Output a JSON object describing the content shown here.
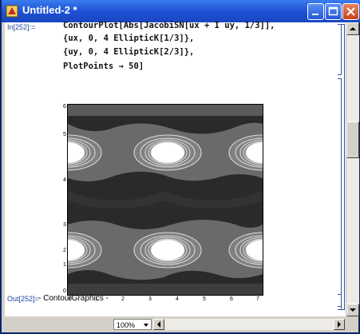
{
  "window": {
    "title": "Untitled-2 *"
  },
  "cell_in": {
    "label": "In[252]:=",
    "lines": [
      "ContourPlot[Abs[JacobiSN[ux + I uy, 1/3]],",
      "{ux, 0, 4 EllipticK[1/3]},",
      "{uy, 0, 4 EllipticK[2/3]},",
      "PlotPoints → 50]"
    ]
  },
  "plot": {
    "yticks": [
      "6",
      "5",
      "4",
      "3",
      "2",
      "1",
      "0"
    ],
    "xticks": [
      "0",
      "1",
      "2",
      "3",
      "4",
      "5",
      "6",
      "7"
    ]
  },
  "cell_out": {
    "label": "Out[252]=",
    "text": "- ContourGraphics -"
  },
  "statusbar": {
    "zoom": "100%"
  },
  "icons": [
    "app-icon",
    "minimize-icon",
    "maximize-icon",
    "close-icon",
    "scroll-up-icon",
    "scroll-down-icon",
    "scroll-left-icon",
    "scroll-right-icon"
  ],
  "colors": {
    "titlebar": "#1c4fd3",
    "plot_dark": "#2a2a2a",
    "plot_mid": "#6a6a6a",
    "plot_light": "#ffffff"
  }
}
